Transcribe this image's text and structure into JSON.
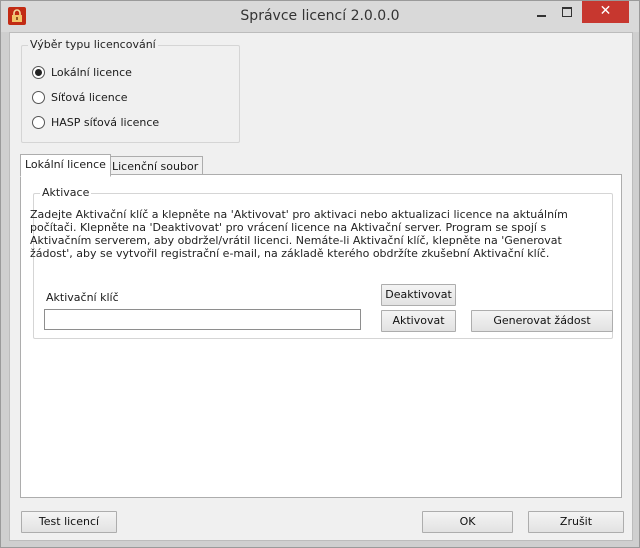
{
  "window": {
    "title": "Správce licencí 2.0.0.0",
    "close_glyph": "✕",
    "icons": {
      "app": "padlock-icon",
      "minimize": "minimize-icon",
      "maximize": "maximize-icon",
      "close": "close-icon"
    }
  },
  "licensing_type": {
    "legend": "Výběr typu licencování",
    "options": [
      {
        "label": "Lokální licence",
        "selected": true
      },
      {
        "label": "Síťová licence",
        "selected": false
      },
      {
        "label": "HASP síťová licence",
        "selected": false
      }
    ]
  },
  "tabs": [
    {
      "label": "Lokální licence",
      "active": true
    },
    {
      "label": "Licenční soubor",
      "active": false
    }
  ],
  "activation": {
    "legend": "Aktivace",
    "description": "Zadejte Aktivační klíč a klepněte na 'Aktivovat' pro aktivaci nebo aktualizaci licence na aktuálním počítači. Klepněte na 'Deaktivovat' pro vrácení licence na Aktivační server. Program se spojí s Aktivačním serverem, aby obdržel/vrátil licenci. Nemáte-li Aktivační klíč, klepněte na 'Generovat žádost', aby se vytvořil registrační e-mail, na základě kterého obdržíte zkušební Aktivační klíč.",
    "key_label": "Aktivační klíč",
    "key_value": "",
    "deactivate_label": "Deaktivovat",
    "activate_label": "Aktivovat",
    "generate_label": "Generovat žádost"
  },
  "footer": {
    "test_label": "Test licencí",
    "ok_label": "OK",
    "cancel_label": "Zrušit"
  }
}
